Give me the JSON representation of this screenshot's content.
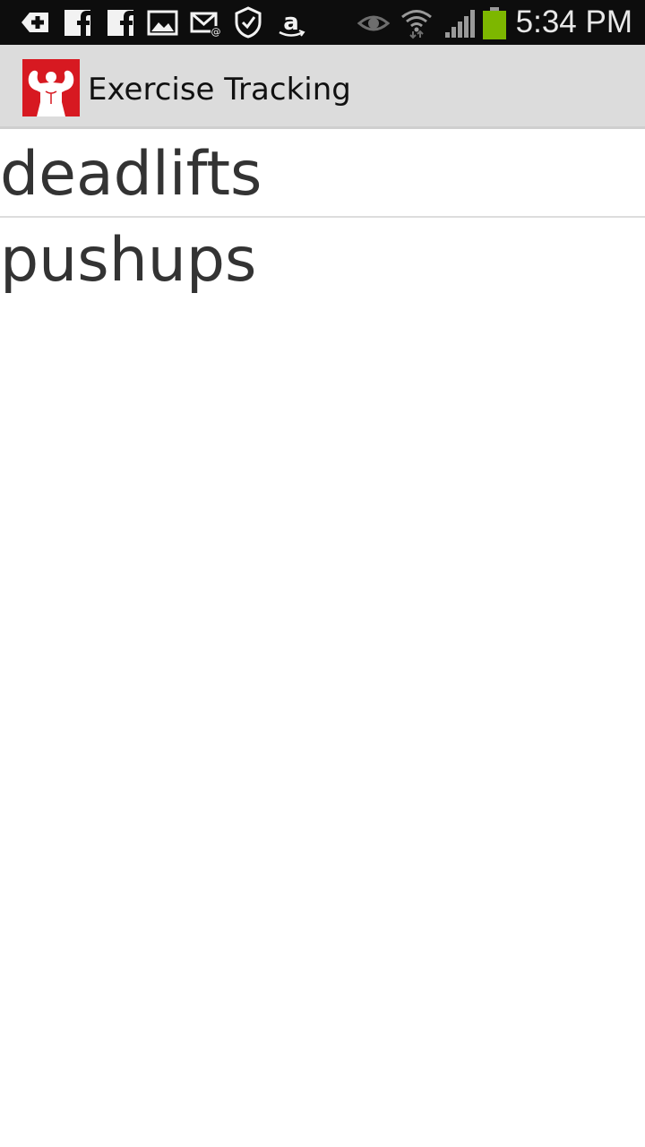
{
  "status_bar": {
    "left_icons": [
      "add-icon",
      "facebook-icon",
      "facebook-icon",
      "gallery-icon",
      "email-icon",
      "security-icon",
      "amazon-icon"
    ],
    "right_icons": [
      "eye-icon",
      "wifi-icon",
      "signal-icon",
      "battery-icon"
    ],
    "time": "5:34 PM",
    "battery_color": "#7db700"
  },
  "action_bar": {
    "app_icon": "bodybuilder-icon",
    "app_icon_color": "#d71921",
    "title": "Exercise Tracking"
  },
  "exercises": [
    {
      "label": "deadlifts"
    },
    {
      "label": "pushups"
    }
  ]
}
